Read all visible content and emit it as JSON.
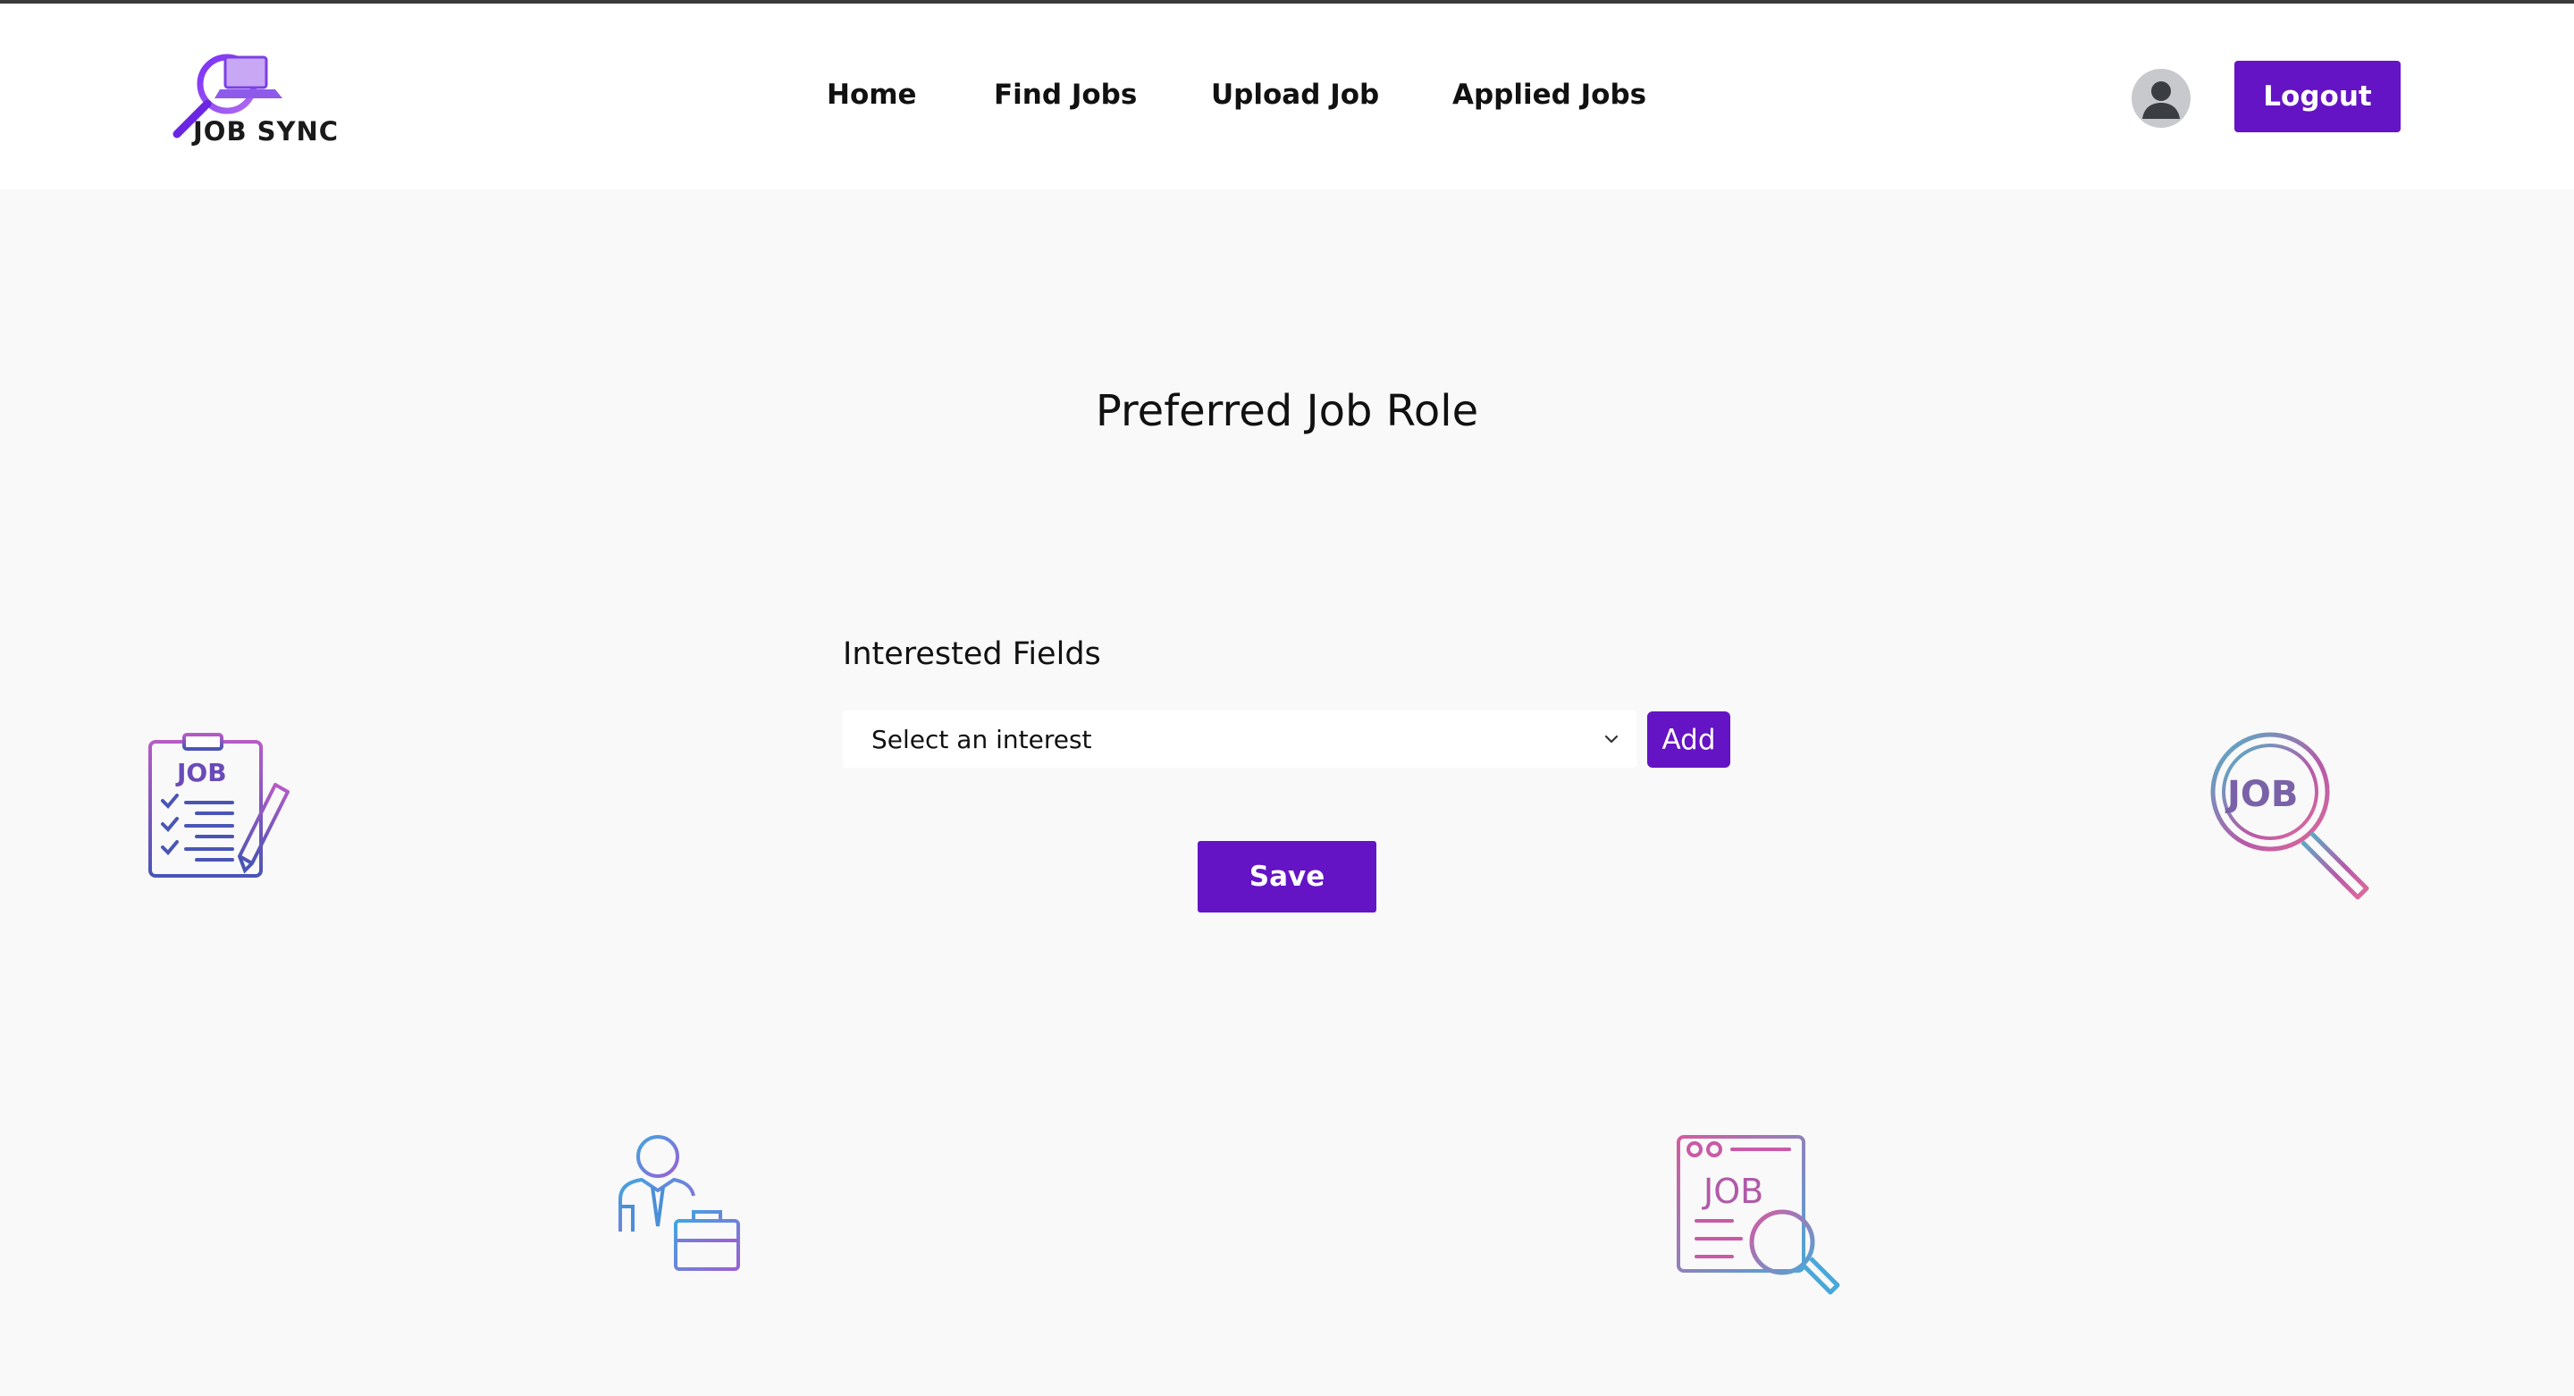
{
  "brand": {
    "logo_text": "JOB SYNC",
    "accent_color": "#6414c4"
  },
  "nav": {
    "items": [
      {
        "label": "Home"
      },
      {
        "label": "Find Jobs"
      },
      {
        "label": "Upload Job"
      },
      {
        "label": "Applied Jobs"
      }
    ]
  },
  "header": {
    "avatar_icon": "user-avatar-icon",
    "logout_label": "Logout"
  },
  "main": {
    "title": "Preferred Job Role",
    "interested_fields_label": "Interested Fields",
    "interest_select": {
      "value": "Select an interest"
    },
    "add_label": "Add",
    "save_label": "Save"
  },
  "decorations": {
    "clipboard_text": "JOB",
    "magnifier_text": "JOB",
    "browser_text": "JOB"
  }
}
